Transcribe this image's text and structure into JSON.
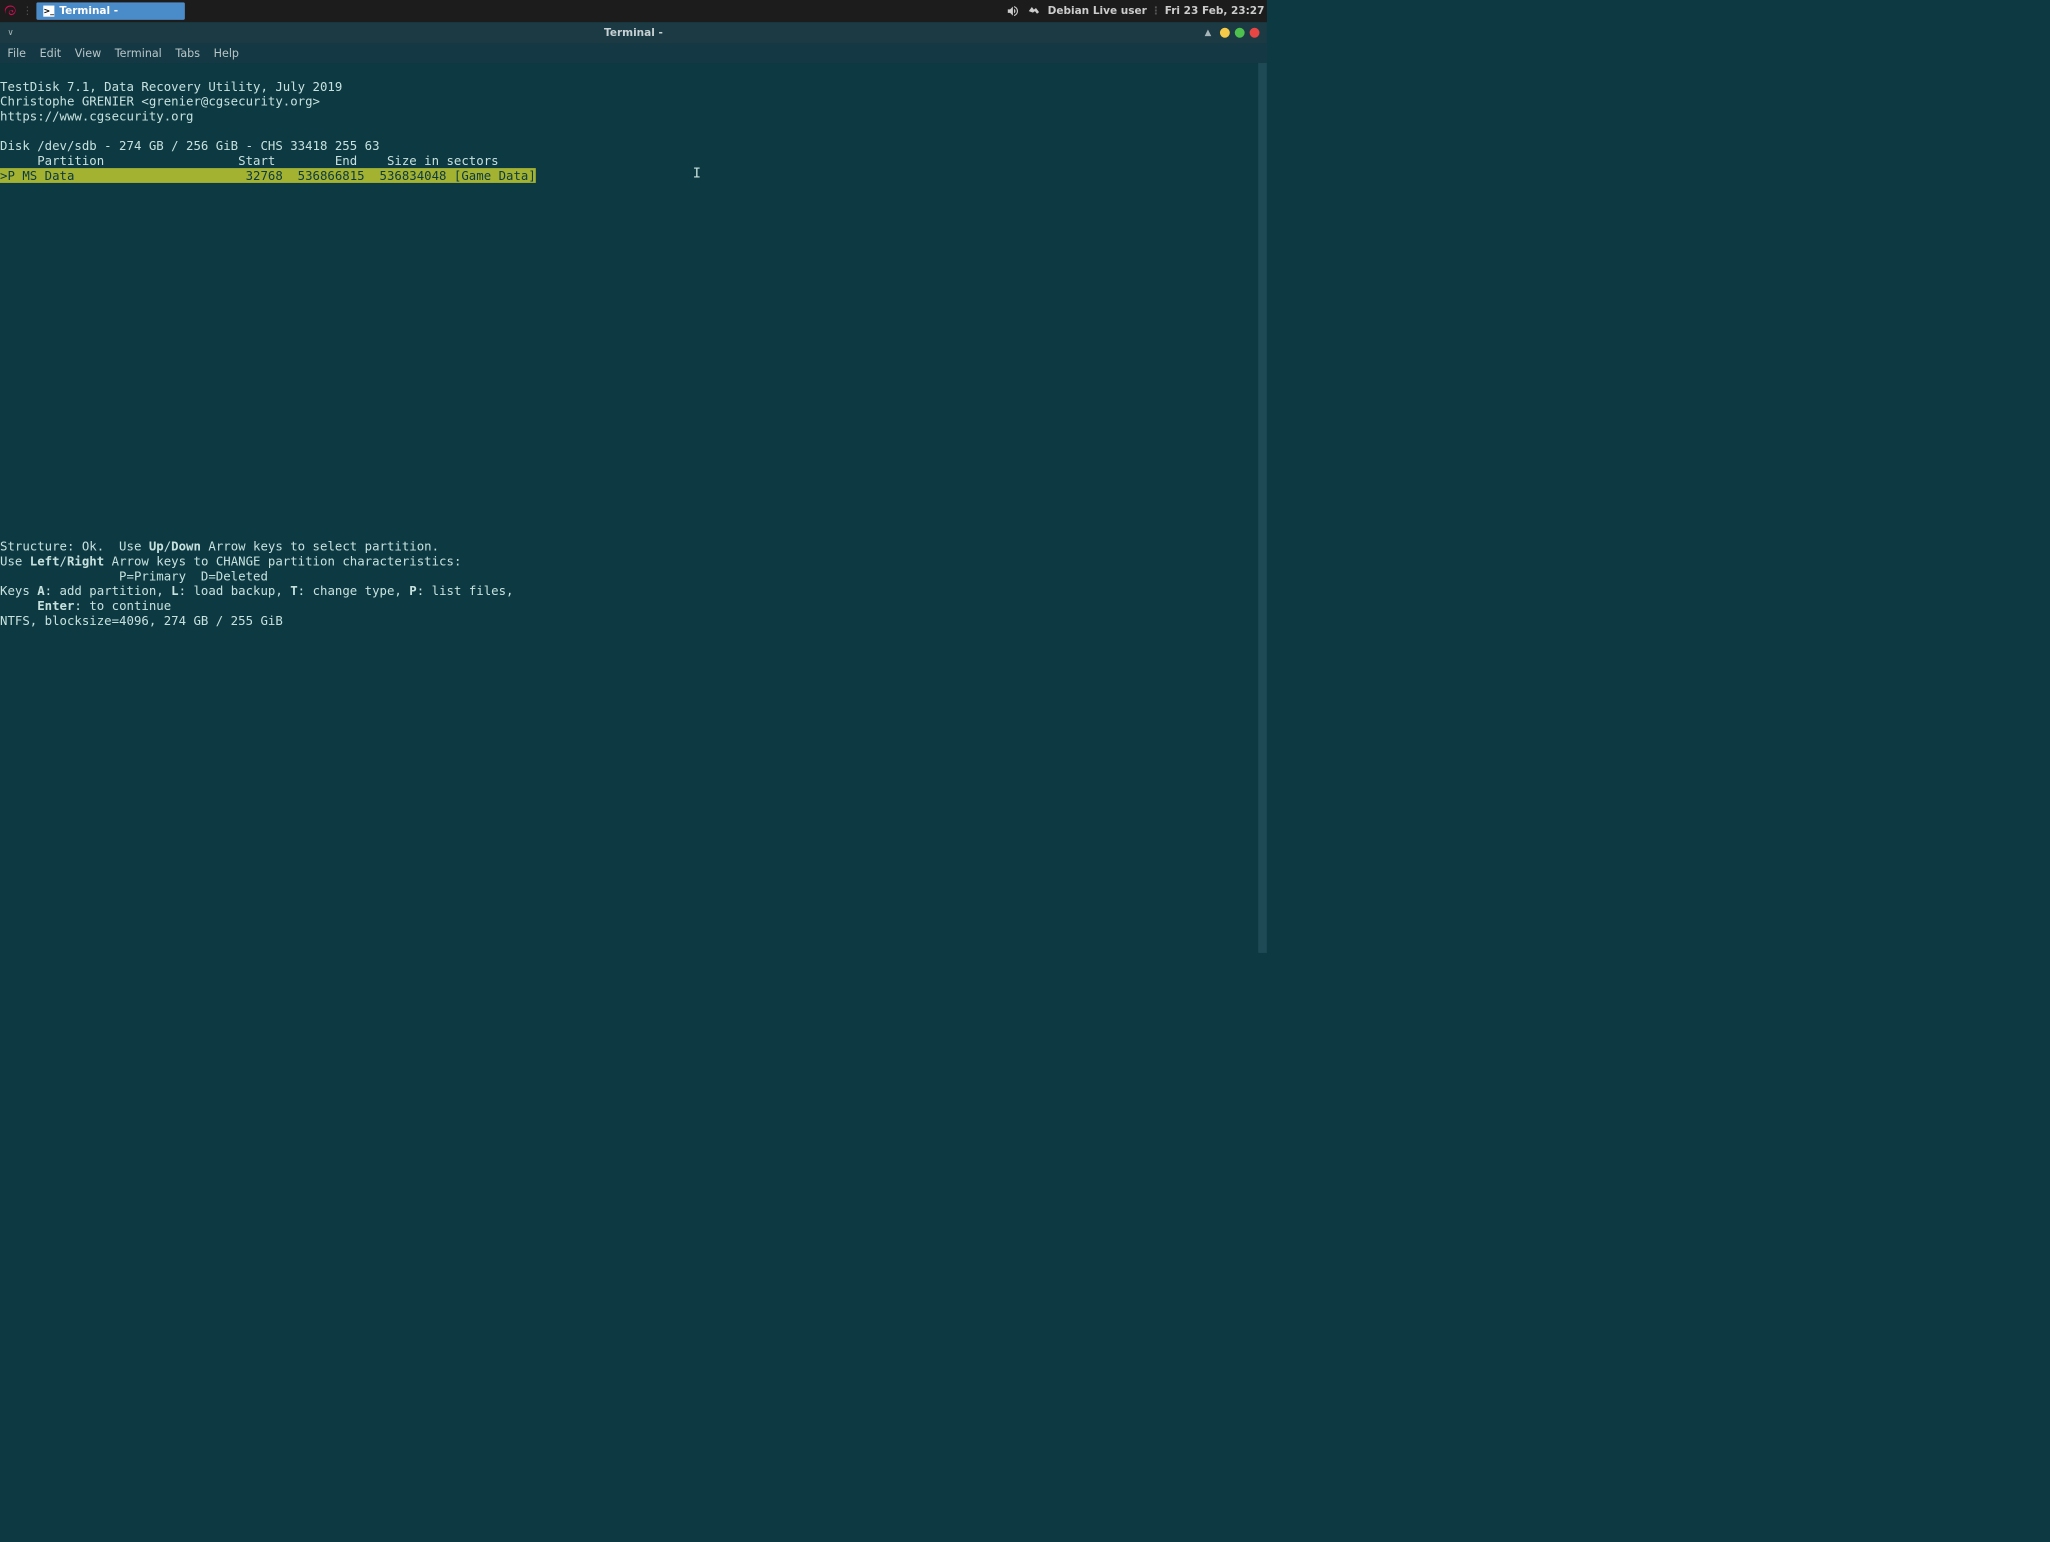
{
  "taskbar": {
    "appLabel": "Terminal -",
    "user": "Debian Live user",
    "date": "Fri 23 Feb, 23:27"
  },
  "window": {
    "title": "Terminal -"
  },
  "menu": {
    "file": "File",
    "edit": "Edit",
    "view": "View",
    "terminal": "Terminal",
    "tabs": "Tabs",
    "help": "Help"
  },
  "term": {
    "header1": "TestDisk 7.1, Data Recovery Utility, July 2019",
    "header2": "Christophe GRENIER <grenier@cgsecurity.org>",
    "header3": "https://www.cgsecurity.org",
    "diskInfo": "Disk /dev/sdb - 274 GB / 256 GiB - CHS 33418 255 63",
    "tableHeader": "     Partition                  Start        End    Size in sectors",
    "rowSel": ">P MS Data                       32768  536866815  536834048 [Game Data]",
    "footer1a": "Structure: Ok.  Use ",
    "footer1_up": "Up",
    "footer1_slash": "/",
    "footer1_down": "Down",
    "footer1b": " Arrow keys to select partition.",
    "footer2a": "Use ",
    "footer2_left": "Left",
    "footer2_slash": "/",
    "footer2_right": "Right",
    "footer2b": " Arrow keys to CHANGE partition characteristics:",
    "footer3": "                P=Primary  D=Deleted",
    "footer4a": "Keys ",
    "footer4_A": "A",
    "footer4b": ": add partition, ",
    "footer4_L": "L",
    "footer4c": ": load backup, ",
    "footer4_T": "T",
    "footer4d": ": change type, ",
    "footer4_P": "P",
    "footer4e": ": list files,",
    "footer5a": "     ",
    "footer5_enter": "Enter",
    "footer5b": ": to continue",
    "footer6": "NTFS, blocksize=4096, 274 GB / 255 GiB"
  }
}
